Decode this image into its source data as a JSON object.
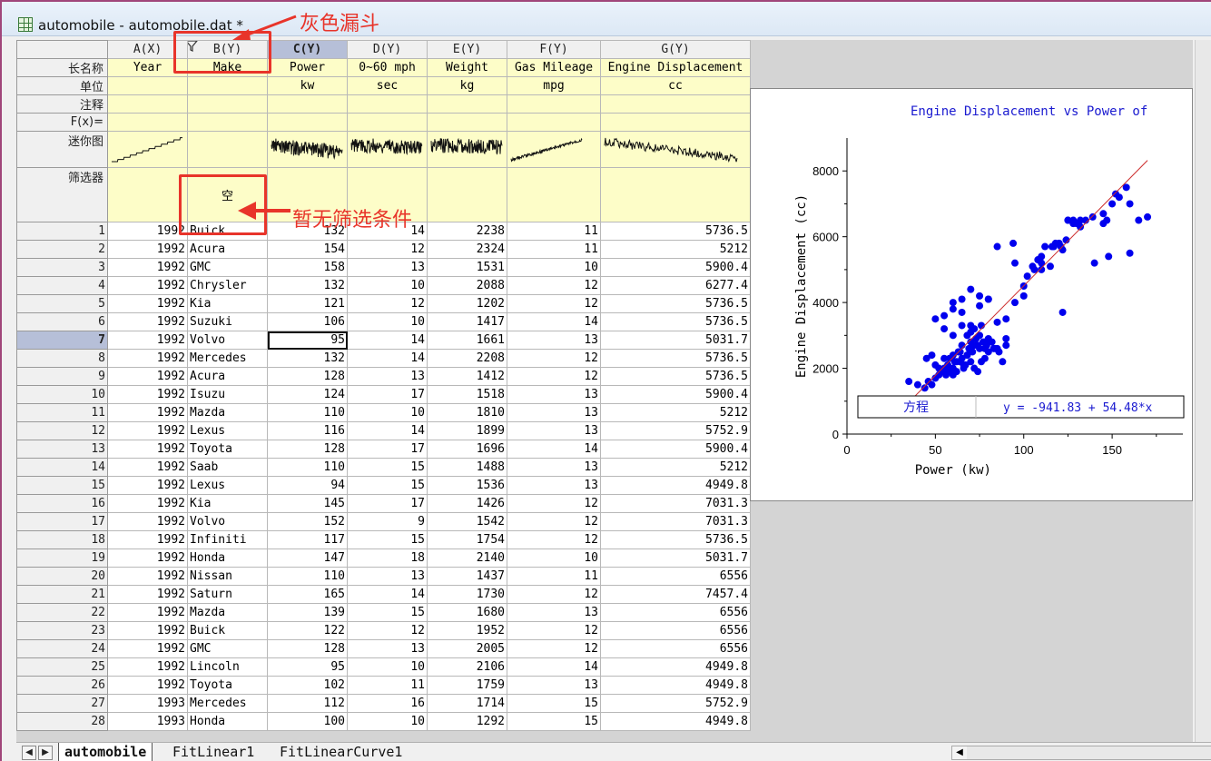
{
  "window": {
    "title": "automobile - automobile.dat *"
  },
  "columns": [
    {
      "id": "A(X)",
      "long_name": "Year",
      "unit": "",
      "align": "num"
    },
    {
      "id": "B(Y)",
      "long_name": "Make",
      "unit": "",
      "align": "txt"
    },
    {
      "id": "C(Y)",
      "long_name": "Power",
      "unit": "kw",
      "align": "num"
    },
    {
      "id": "D(Y)",
      "long_name": "0~60 mph",
      "unit": "sec",
      "align": "num"
    },
    {
      "id": "E(Y)",
      "long_name": "Weight",
      "unit": "kg",
      "align": "num"
    },
    {
      "id": "F(Y)",
      "long_name": "Gas Mileage",
      "unit": "mpg",
      "align": "num"
    },
    {
      "id": "G(Y)",
      "long_name": "Engine Displacement",
      "unit": "cc",
      "align": "num"
    }
  ],
  "meta_rows": [
    "长名称",
    "单位",
    "注释",
    "F(x)=",
    "迷你图",
    "筛选器"
  ],
  "filter_cell_text": "空",
  "rows": [
    [
      "1",
      "1992",
      "Buick",
      "132",
      "14",
      "2238",
      "11",
      "5736.5"
    ],
    [
      "2",
      "1992",
      "Acura",
      "154",
      "12",
      "2324",
      "11",
      "5212"
    ],
    [
      "3",
      "1992",
      "GMC",
      "158",
      "13",
      "1531",
      "10",
      "5900.4"
    ],
    [
      "4",
      "1992",
      "Chrysler",
      "132",
      "10",
      "2088",
      "12",
      "6277.4"
    ],
    [
      "5",
      "1992",
      "Kia",
      "121",
      "12",
      "1202",
      "12",
      "5736.5"
    ],
    [
      "6",
      "1992",
      "Suzuki",
      "106",
      "10",
      "1417",
      "14",
      "5736.5"
    ],
    [
      "7",
      "1992",
      "Volvo",
      "95",
      "14",
      "1661",
      "13",
      "5031.7"
    ],
    [
      "8",
      "1992",
      "Mercedes",
      "132",
      "14",
      "2208",
      "12",
      "5736.5"
    ],
    [
      "9",
      "1992",
      "Acura",
      "128",
      "13",
      "1412",
      "12",
      "5736.5"
    ],
    [
      "10",
      "1992",
      "Isuzu",
      "124",
      "17",
      "1518",
      "13",
      "5900.4"
    ],
    [
      "11",
      "1992",
      "Mazda",
      "110",
      "10",
      "1810",
      "13",
      "5212"
    ],
    [
      "12",
      "1992",
      "Lexus",
      "116",
      "14",
      "1899",
      "13",
      "5752.9"
    ],
    [
      "13",
      "1992",
      "Toyota",
      "128",
      "17",
      "1696",
      "14",
      "5900.4"
    ],
    [
      "14",
      "1992",
      "Saab",
      "110",
      "15",
      "1488",
      "13",
      "5212"
    ],
    [
      "15",
      "1992",
      "Lexus",
      "94",
      "15",
      "1536",
      "13",
      "4949.8"
    ],
    [
      "16",
      "1992",
      "Kia",
      "145",
      "17",
      "1426",
      "12",
      "7031.3"
    ],
    [
      "17",
      "1992",
      "Volvo",
      "152",
      "9",
      "1542",
      "12",
      "7031.3"
    ],
    [
      "18",
      "1992",
      "Infiniti",
      "117",
      "15",
      "1754",
      "12",
      "5736.5"
    ],
    [
      "19",
      "1992",
      "Honda",
      "147",
      "18",
      "2140",
      "10",
      "5031.7"
    ],
    [
      "20",
      "1992",
      "Nissan",
      "110",
      "13",
      "1437",
      "11",
      "6556"
    ],
    [
      "21",
      "1992",
      "Saturn",
      "165",
      "14",
      "1730",
      "12",
      "7457.4"
    ],
    [
      "22",
      "1992",
      "Mazda",
      "139",
      "15",
      "1680",
      "13",
      "6556"
    ],
    [
      "23",
      "1992",
      "Buick",
      "122",
      "12",
      "1952",
      "12",
      "6556"
    ],
    [
      "24",
      "1992",
      "GMC",
      "128",
      "13",
      "2005",
      "12",
      "6556"
    ],
    [
      "25",
      "1992",
      "Lincoln",
      "95",
      "10",
      "2106",
      "14",
      "4949.8"
    ],
    [
      "26",
      "1992",
      "Toyota",
      "102",
      "11",
      "1759",
      "13",
      "4949.8"
    ],
    [
      "27",
      "1993",
      "Mercedes",
      "112",
      "16",
      "1714",
      "15",
      "5752.9"
    ],
    [
      "28",
      "1993",
      "Honda",
      "100",
      "10",
      "1292",
      "15",
      "4949.8"
    ]
  ],
  "selected": {
    "row": 7,
    "column": "C(Y)"
  },
  "tabs": [
    {
      "label": "automobile",
      "active": true
    },
    {
      "label": "FitLinear1",
      "active": false
    },
    {
      "label": "FitLinearCurve1",
      "active": false
    }
  ],
  "annotations": {
    "filter_icon_label": "灰色漏斗",
    "no_filter_label": "暂无筛选条件",
    "color": "#e8342a"
  },
  "chart_data": {
    "type": "scatter",
    "title": "Engine Displacement vs Power of",
    "xlabel": "Power (kw)",
    "ylabel": "Engine Displacement (cc)",
    "xlim": [
      0,
      190
    ],
    "ylim": [
      0,
      9000
    ],
    "xticks": [
      0,
      50,
      100,
      150
    ],
    "yticks": [
      0,
      2000,
      4000,
      6000,
      8000
    ],
    "point_color": "#0000ee",
    "fit_line": {
      "intercept": -941.83,
      "slope": 54.48,
      "color": "#cc2a2a"
    },
    "legend_table": {
      "label": "方程",
      "equation": "y = -941.83 + 54.48*x"
    },
    "series": [
      {
        "x": [
          35,
          40,
          44,
          46,
          48,
          50,
          52,
          54,
          55,
          56,
          57,
          58,
          60,
          60,
          61,
          62,
          63,
          64,
          65,
          65,
          66,
          67,
          68,
          68,
          69,
          70,
          70,
          71,
          72,
          73,
          74,
          75,
          75,
          76,
          77,
          78,
          79,
          80,
          80,
          82,
          83,
          84,
          86,
          88,
          90,
          45,
          48,
          50,
          52,
          55,
          58,
          60,
          62,
          64,
          66,
          68,
          70,
          72,
          74,
          76,
          78,
          50,
          55,
          60,
          65,
          70,
          75,
          80,
          85,
          90,
          95,
          100,
          100,
          102,
          105,
          106,
          108,
          110,
          110,
          112,
          115,
          116,
          117,
          120,
          121,
          122,
          124,
          125,
          128,
          128,
          130,
          132,
          132,
          135,
          139,
          145,
          147,
          150,
          152,
          154,
          158,
          160,
          165,
          170,
          110,
          95,
          94,
          85,
          80,
          75,
          70,
          65,
          60,
          55,
          60,
          65,
          70,
          72,
          78,
          85,
          90,
          122,
          118,
          125,
          130,
          148,
          140,
          145,
          160
        ],
        "y": [
          1600,
          1500,
          1400,
          1600,
          1500,
          1700,
          1800,
          1900,
          2000,
          1800,
          2100,
          2300,
          2000,
          2400,
          2200,
          1900,
          2500,
          2200,
          2300,
          2700,
          2000,
          2100,
          2400,
          3000,
          2600,
          2200,
          2800,
          2500,
          3200,
          2900,
          2700,
          3000,
          2600,
          3300,
          2800,
          2600,
          2700,
          2500,
          2900,
          2800,
          2600,
          2600,
          2500,
          2200,
          2700,
          2300,
          2400,
          2100,
          2000,
          2300,
          1900,
          1800,
          2200,
          2500,
          2100,
          2400,
          2600,
          2000,
          1900,
          2200,
          2300,
          3500,
          3600,
          3800,
          3700,
          3300,
          3900,
          4100,
          3400,
          3500,
          4000,
          4500,
          4200,
          4800,
          5100,
          5000,
          5300,
          5200,
          5400,
          5700,
          5100,
          5700,
          5700,
          5800,
          5700,
          5600,
          5900,
          6500,
          6500,
          6400,
          6400,
          6500,
          6300,
          6500,
          6600,
          6400,
          6500,
          7000,
          7300,
          7200,
          7500,
          7000,
          6500,
          6600,
          5000,
          5200,
          5800,
          5700,
          4100,
          4200,
          4400,
          4100,
          4000,
          3200,
          3000,
          3300,
          3100,
          2700,
          2800,
          2600,
          2900,
          3700,
          5800,
          6500,
          6400,
          5400,
          5200,
          6700,
          5500
        ]
      }
    ]
  }
}
